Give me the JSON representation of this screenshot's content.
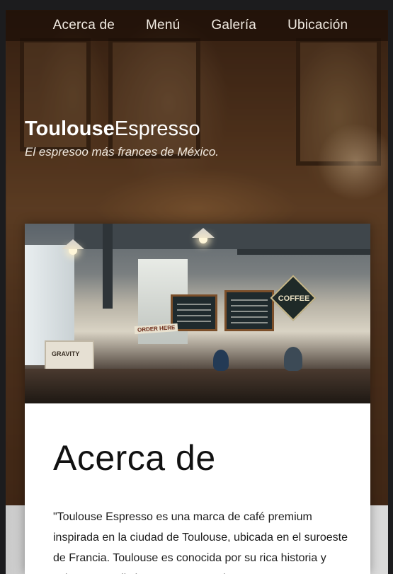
{
  "nav": {
    "items": [
      {
        "label": "Acerca de"
      },
      {
        "label": "Menú"
      },
      {
        "label": "Galería"
      },
      {
        "label": "Ubicación"
      }
    ]
  },
  "hero": {
    "brand_bold": "Toulouse",
    "brand_light": "Espresso",
    "tagline": "El espresoo más frances de México."
  },
  "photo": {
    "sign_coffee": "COFFEE",
    "sign_order": "ORDER HERE",
    "crate_label": "GRAVITY"
  },
  "about": {
    "heading": "Acerca de",
    "body": "\"Toulouse Espresso es una marca de café premium inspirada en la ciudad de Toulouse, ubicada en el suroeste de Francia. Toulouse es conocida por su rica historia y cultura, y se distingue por su arquitectura..."
  },
  "colors": {
    "accent": "#ffffff",
    "background": "#4a3322"
  }
}
